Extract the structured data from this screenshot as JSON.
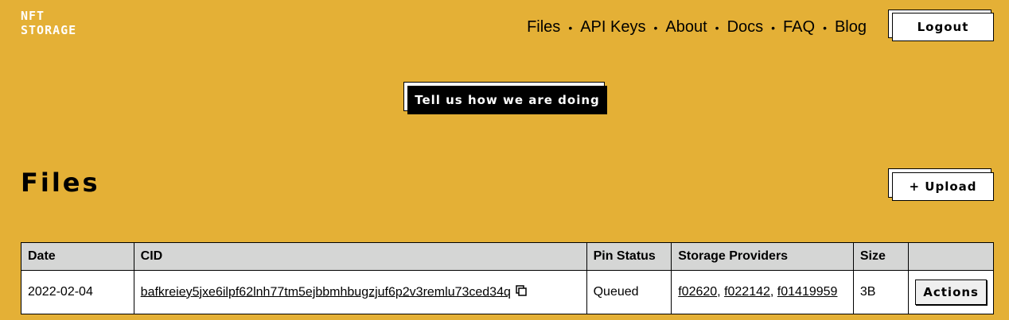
{
  "brand": {
    "line1": "NFT",
    "line2": "STORAGE"
  },
  "nav": {
    "items": [
      "Files",
      "API Keys",
      "About",
      "Docs",
      "FAQ",
      "Blog"
    ],
    "separator": "•",
    "logout_label": "Logout"
  },
  "feedback": {
    "label": "Tell us how we are doing"
  },
  "files": {
    "title": "Files",
    "upload_label": "+ Upload",
    "columns": [
      "Date",
      "CID",
      "Pin Status",
      "Storage Providers",
      "Size",
      ""
    ],
    "rows": [
      {
        "date": "2022-02-04",
        "cid": "bafkreiey5jxe6ilpf62lnh77tm5ejbbmhbugzjuf6p2v3remlu73ced34q",
        "copy_icon": "copy-icon",
        "pin_status": "Queued",
        "providers": [
          "f02620",
          "f022142",
          "f01419959"
        ],
        "size": "3B",
        "actions_label": "Actions"
      }
    ]
  },
  "colors": {
    "background": "#E4B036",
    "header_row": "#D5D6D5",
    "feedback_button": "#000000"
  }
}
